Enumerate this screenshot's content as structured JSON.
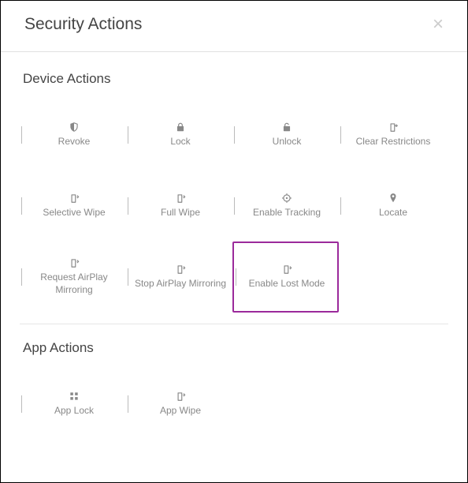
{
  "header": {
    "title": "Security Actions"
  },
  "sections": {
    "device": {
      "title": "Device Actions",
      "items": [
        {
          "label": "Revoke"
        },
        {
          "label": "Lock"
        },
        {
          "label": "Unlock"
        },
        {
          "label": "Clear Restrictions"
        },
        {
          "label": "Selective Wipe"
        },
        {
          "label": "Full Wipe"
        },
        {
          "label": "Enable Tracking"
        },
        {
          "label": "Locate"
        },
        {
          "label": "Request AirPlay Mirroring"
        },
        {
          "label": "Stop AirPlay Mirroring"
        },
        {
          "label": "Enable Lost Mode"
        }
      ]
    },
    "app": {
      "title": "App Actions",
      "items": [
        {
          "label": "App Lock"
        },
        {
          "label": "App Wipe"
        }
      ]
    }
  },
  "highlighted": "enable-lost-mode"
}
